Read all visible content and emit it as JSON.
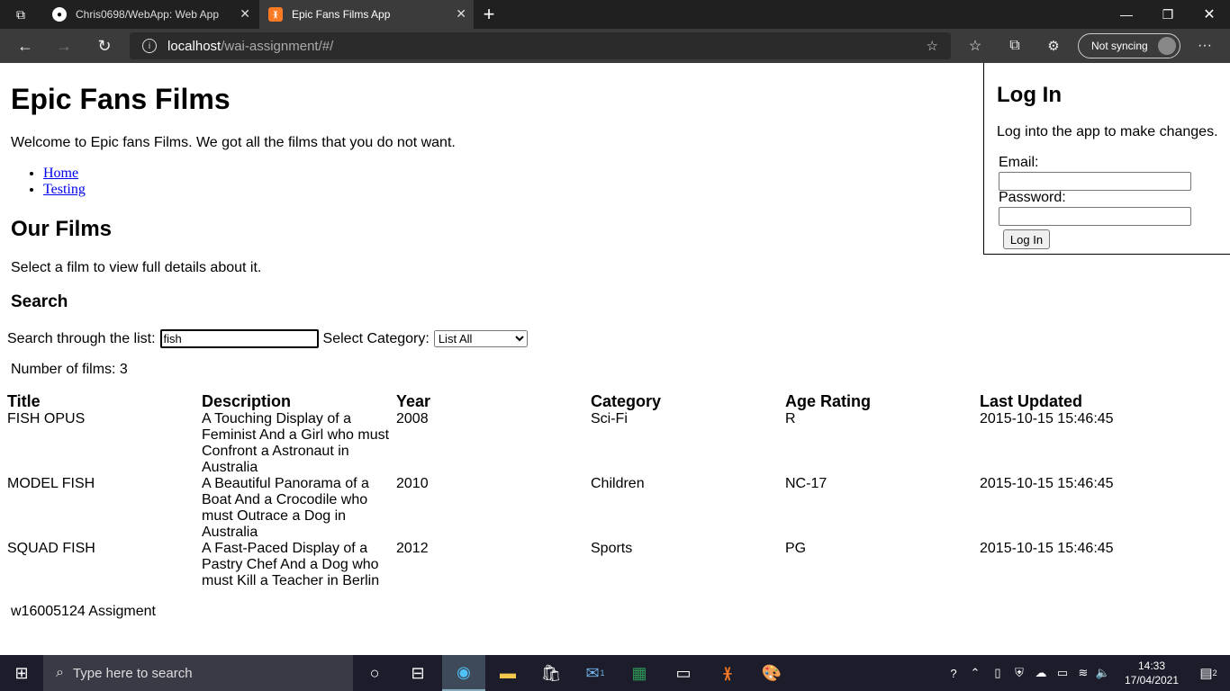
{
  "browser": {
    "tabs": [
      {
        "title": "Chris0698/WebApp: Web App",
        "icon": "github-icon"
      },
      {
        "title": "Epic Fans Films App",
        "icon": "xampp-icon"
      }
    ],
    "url_host": "localhost",
    "url_path": "/wai-assignment/#/",
    "sync_label": "Not syncing"
  },
  "page": {
    "title": "Epic Fans Films",
    "welcome": "Welcome to Epic fans Films. We got all the films that you do not want.",
    "nav": [
      "Home",
      "Testing"
    ],
    "films_heading": "Our Films",
    "films_subtext": "Select a film to view full details about it.",
    "search_heading": "Search",
    "search_label": "Search through the list:",
    "search_value": "fish",
    "category_label": "Select Category:",
    "category_selected": "List All",
    "count_text": "Number of films: 3",
    "table": {
      "headers": [
        "Title",
        "Description",
        "Year",
        "Category",
        "Age Rating",
        "Last Updated"
      ],
      "rows": [
        [
          "FISH OPUS",
          "A Touching Display of a Feminist And a Girl who must Confront a Astronaut in Australia",
          "2008",
          "Sci-Fi",
          "R",
          "2015-10-15 15:46:45"
        ],
        [
          "MODEL FISH",
          "A Beautiful Panorama of a Boat And a Crocodile who must Outrace a Dog in Australia",
          "2010",
          "Children",
          "NC-17",
          "2015-10-15 15:46:45"
        ],
        [
          "SQUAD FISH",
          "A Fast-Paced Display of a Pastry Chef And a Dog who must Kill a Teacher in Berlin",
          "2012",
          "Sports",
          "PG",
          "2015-10-15 15:46:45"
        ]
      ]
    },
    "footer": "w16005124 Assigment"
  },
  "login": {
    "heading": "Log In",
    "message": "Log into the app to make changes.",
    "email_label": "Email:",
    "password_label": "Password:",
    "button": "Log In"
  },
  "taskbar": {
    "search_placeholder": "Type here to search",
    "time": "14:33",
    "date": "17/04/2021",
    "notification_count": "2",
    "mail_badge": "1"
  }
}
